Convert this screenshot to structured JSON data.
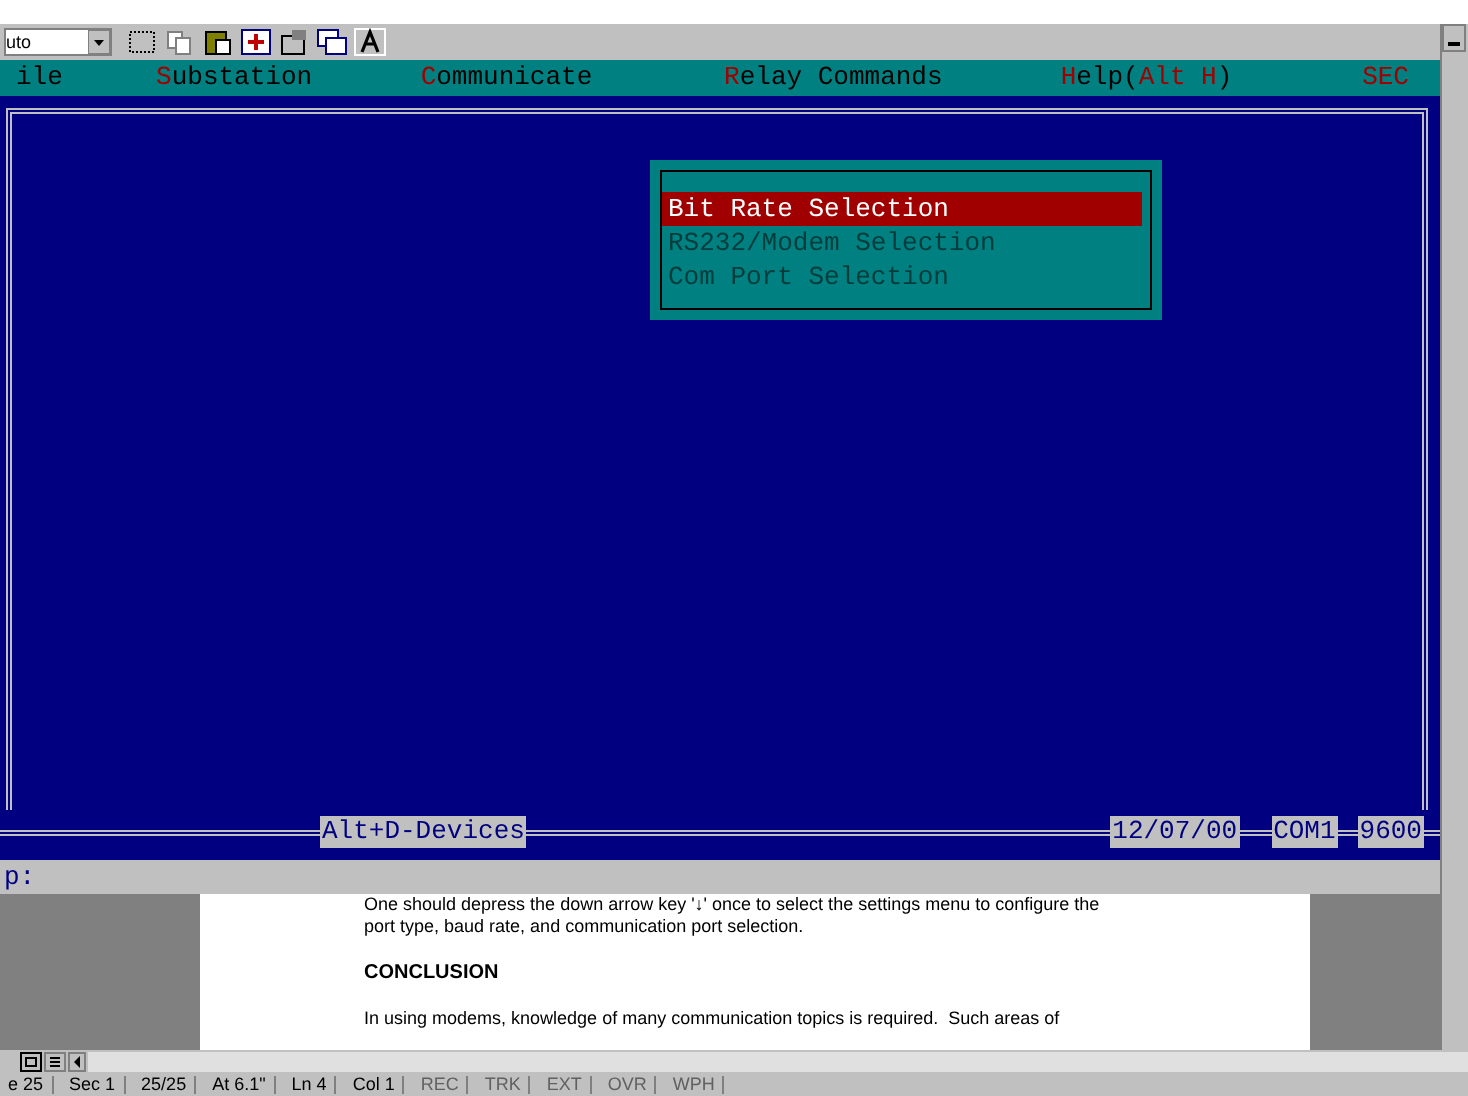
{
  "toolbar": {
    "dropdown_value": "uto"
  },
  "menu_bar": [
    {
      "parts": [
        {
          "text": "ile",
          "hotkey": false
        }
      ]
    },
    {
      "parts": [
        {
          "text": "S",
          "hotkey": true
        },
        {
          "text": "ubstation",
          "hotkey": false
        }
      ]
    },
    {
      "parts": [
        {
          "text": "C",
          "hotkey": true
        },
        {
          "text": "ommunicate",
          "hotkey": false
        }
      ]
    },
    {
      "parts": [
        {
          "text": "R",
          "hotkey": true
        },
        {
          "text": "elay Commands",
          "hotkey": false
        }
      ]
    },
    {
      "parts": [
        {
          "text": "H",
          "hotkey": true
        },
        {
          "text": "elp(",
          "hotkey": false
        },
        {
          "text": "Alt H",
          "hotkey": true
        },
        {
          "text": ")",
          "hotkey": false
        }
      ]
    },
    {
      "parts": [
        {
          "text": "SEC",
          "hotkey": true
        }
      ]
    }
  ],
  "popup_menu": [
    {
      "label": "Bit Rate Selection",
      "selected": true
    },
    {
      "label": "RS232/Modem Selection",
      "selected": false
    },
    {
      "label": "Com Port Selection",
      "selected": false
    }
  ],
  "terminal_status": {
    "hint": "Alt+D-Devices",
    "date": "12/07/00",
    "port": "COM1",
    "baud": "9600"
  },
  "prompt": "p:",
  "document": [
    {
      "kind": "body",
      "text": "One should depress the down arrow key '↓' once to select the settings menu to configure the"
    },
    {
      "kind": "body",
      "text": "port type, baud rate, and communication port selection."
    },
    {
      "kind": "heading",
      "text": "CONCLUSION"
    },
    {
      "kind": "body",
      "text": "In using modems, knowledge of many communication topics is required.  Such areas of"
    }
  ],
  "status_bar": [
    {
      "text": "e 25",
      "disabled": false
    },
    {
      "text": "Sec 1",
      "disabled": false
    },
    {
      "text": "25/25",
      "disabled": false
    },
    {
      "text": "At 6.1\"",
      "disabled": false
    },
    {
      "text": "Ln 4",
      "disabled": false
    },
    {
      "text": "Col 1",
      "disabled": false
    },
    {
      "text": "REC",
      "disabled": true
    },
    {
      "text": "TRK",
      "disabled": true
    },
    {
      "text": "EXT",
      "disabled": true
    },
    {
      "text": "OVR",
      "disabled": true
    },
    {
      "text": "WPH",
      "disabled": true
    }
  ]
}
